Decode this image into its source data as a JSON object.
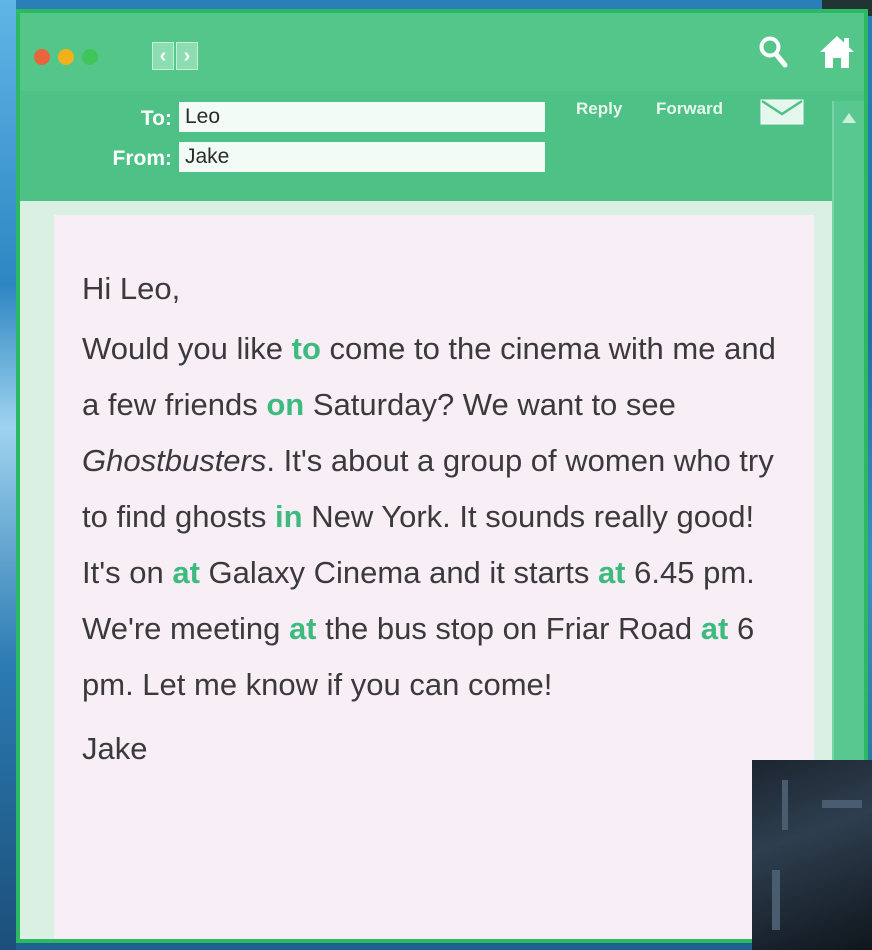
{
  "header": {
    "to_label": "To:",
    "to_value": "Leo",
    "from_label": "From:",
    "from_value": "Jake",
    "reply_label": "Reply",
    "forward_label": "Forward"
  },
  "icons": {
    "search": "search-icon",
    "home": "home-icon",
    "envelope": "envelope-icon",
    "back": "chevron-left-icon",
    "forward": "chevron-right-icon"
  },
  "colors": {
    "window_green": "#4fc389",
    "highlight_green": "#3dbb7f",
    "message_background": "#f8eef6"
  },
  "message": {
    "greeting": "Hi Leo,",
    "body": [
      {
        "t": "Would you like "
      },
      {
        "t": "to",
        "hl": true
      },
      {
        "t": " come to the cinema with me and a few friends "
      },
      {
        "t": "on",
        "hl": true
      },
      {
        "t": " Saturday? We want to see "
      },
      {
        "t": "Ghostbusters",
        "it": true
      },
      {
        "t": ". It's about a group of women who try to find ghosts "
      },
      {
        "t": "in",
        "hl": true
      },
      {
        "t": " New York. It sounds really good! It's on "
      },
      {
        "t": "at",
        "hl": true
      },
      {
        "t": " Galaxy Cinema and it starts "
      },
      {
        "t": "at",
        "hl": true
      },
      {
        "t": " 6.45 pm. We're meeting "
      },
      {
        "t": "at",
        "hl": true
      },
      {
        "t": " the bus stop on Friar Road "
      },
      {
        "t": "at",
        "hl": true
      },
      {
        "t": " 6 pm. Let me know if you can come!"
      }
    ],
    "signature": "Jake"
  }
}
